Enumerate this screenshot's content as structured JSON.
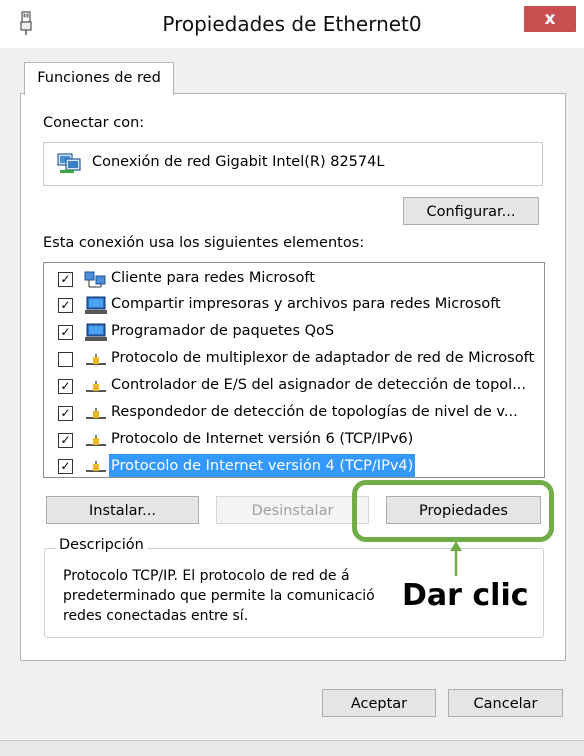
{
  "window": {
    "title": "Propiedades de Ethernet0",
    "close_label": "x"
  },
  "tabs": [
    {
      "label": "Funciones de red"
    }
  ],
  "connect": {
    "label": "Conectar con:",
    "adapter_name": "Conexión de red Gigabit Intel(R) 82574L",
    "configure_label": "Configurar..."
  },
  "components": {
    "label": "Esta conexión usa los siguientes elementos:",
    "items": [
      {
        "label": "Cliente para redes Microsoft",
        "checked": true,
        "icon": "network-client-icon"
      },
      {
        "label": "Compartir impresoras y archivos para redes Microsoft",
        "checked": true,
        "icon": "computer-icon"
      },
      {
        "label": "Programador de paquetes QoS",
        "checked": true,
        "icon": "computer-icon"
      },
      {
        "label": "Protocolo de multiplexor de adaptador de red de Microsoft",
        "checked": false,
        "icon": "protocol-icon"
      },
      {
        "label": "Controlador de E/S del asignador de detección de topol...",
        "checked": true,
        "icon": "protocol-icon"
      },
      {
        "label": "Respondedor de detección de topologías de nivel de v...",
        "checked": true,
        "icon": "protocol-icon"
      },
      {
        "label": "Protocolo de Internet versión 6 (TCP/IPv6)",
        "checked": true,
        "icon": "protocol-icon"
      },
      {
        "label": "Protocolo de Internet versión 4 (TCP/IPv4)",
        "checked": true,
        "icon": "protocol-icon",
        "selected": true
      }
    ]
  },
  "actions": {
    "install_label": "Instalar...",
    "uninstall_label": "Desinstalar",
    "properties_label": "Propiedades"
  },
  "description": {
    "legend": "Descripción",
    "lines": [
      "Protocolo TCP/IP. El protocolo de red de á",
      "predeterminado que permite la comunicació",
      "redes conectadas entre sí."
    ]
  },
  "annotation": {
    "text": "Dar clic",
    "color": "#70ad47"
  },
  "footer": {
    "ok_label": "Aceptar",
    "cancel_label": "Cancelar"
  },
  "colors": {
    "selection": "#3399ff",
    "close_button": "#c74f50"
  }
}
